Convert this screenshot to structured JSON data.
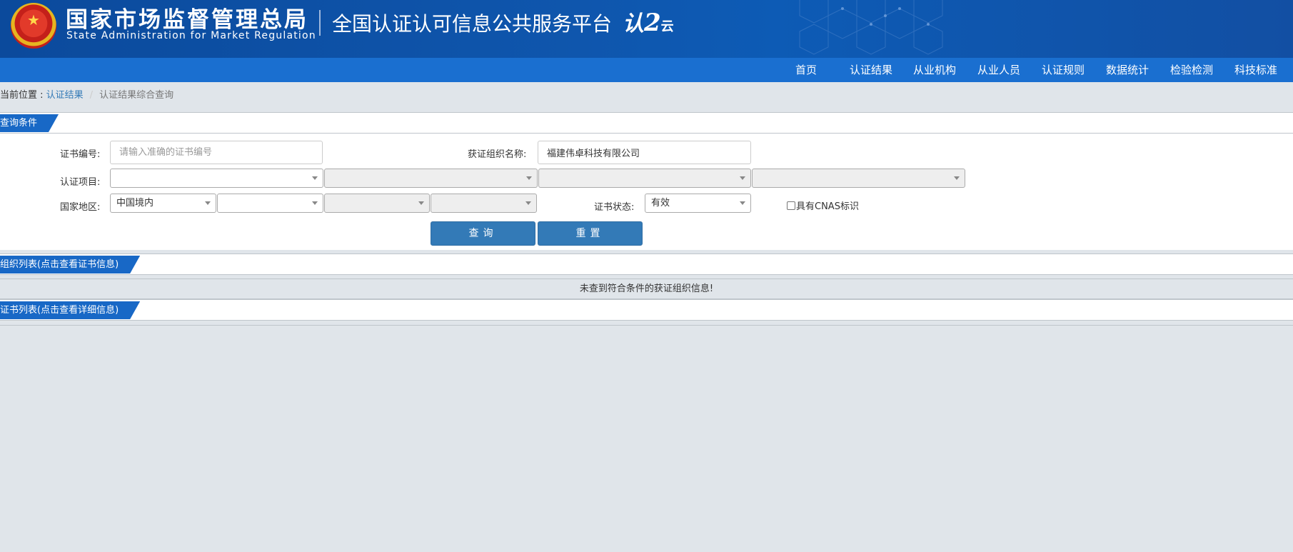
{
  "header": {
    "agency_cn": "国家市场监督管理总局",
    "agency_en": "State Administration  for  Market Regulation",
    "platform": "全国认证认可信息公共服务平台",
    "logo_main": "认",
    "logo_sub": "云"
  },
  "nav": {
    "items": [
      "首页",
      "认证结果",
      "从业机构",
      "从业人员",
      "认证规则",
      "数据统计",
      "检验检测",
      "科技标准"
    ]
  },
  "breadcrumb": {
    "label": "当前位置 : ",
    "link": "认证结果",
    "separator": "/",
    "current": "认证结果综合查询"
  },
  "query": {
    "section_title": "查询条件",
    "cert_no_label": "证书编号:",
    "cert_no_placeholder": "请输入准确的证书编号",
    "org_name_label": "获证组织名称:",
    "org_name_value": "福建伟卓科技有限公司",
    "project_label": "认证项目:",
    "project_selects": [
      "",
      "",
      "",
      ""
    ],
    "region_label": "国家地区:",
    "region_selects": [
      "中国境内",
      "",
      "",
      ""
    ],
    "status_label": "证书状态:",
    "status_value": "有效",
    "cnas_label": "具有CNAS标识",
    "search_button": "查询",
    "reset_button": "重置"
  },
  "org_list": {
    "section_title": "组织列表(点击查看证书信息)",
    "empty_message": "未查到符合条件的获证组织信息!"
  },
  "cert_list": {
    "section_title": "证书列表(点击查看详细信息)"
  },
  "colors": {
    "banner": "#0f56ad",
    "nav": "#1a6fd0",
    "section_tab": "#1868c6",
    "button": "#337ab7",
    "link": "#337ab7"
  }
}
